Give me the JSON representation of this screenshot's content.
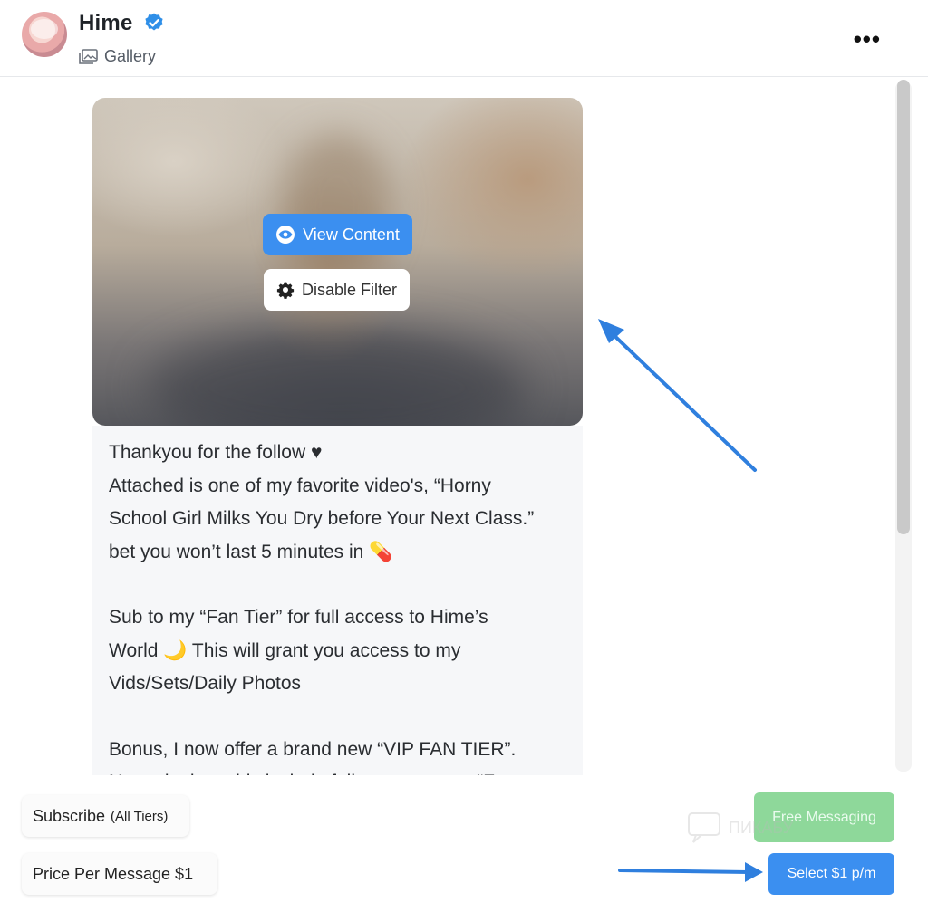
{
  "header": {
    "name": "Hime",
    "subtitle": "Gallery",
    "more_label": "•••"
  },
  "post": {
    "view_content_label": "View Content",
    "disable_filter_label": "Disable Filter",
    "caption_lines": [
      "Thankyou for the follow ♥",
      "Attached is one of my favorite video's, “Horny",
      "School Girl Milks You Dry before Your Next Class.”",
      "bet you won’t last 5 minutes in 💊",
      "",
      "Sub to my “Fan Tier” for full access to Hime’s",
      "World 🌙 This will grant you access to my",
      "Vids/Sets/Daily Photos",
      "",
      "Bonus, I now offer a brand new “VIP FAN TIER”.",
      "Not only does this include full access to my “F"
    ]
  },
  "actions": {
    "subscribe_label": "Subscribe",
    "subscribe_suffix": "(All Tiers)",
    "price_label": "Price Per Message $1",
    "free_messaging_label": "Free Messaging",
    "select_label": "Select $1 p/m"
  },
  "watermark": "ПИКАБУ",
  "colors": {
    "accent_blue": "#3b8ff0",
    "free_green": "#8ed89a",
    "arrow_blue": "#2f7fde",
    "caption_bg": "#f6f7f9"
  },
  "icons": {
    "verified": "verified-badge-icon",
    "gallery": "gallery-icon",
    "more": "more-dots-icon",
    "eye": "eye-icon",
    "gear": "gear-icon"
  }
}
